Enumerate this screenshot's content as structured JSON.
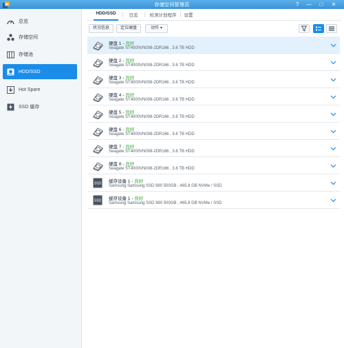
{
  "window": {
    "title": "存储空间管理员",
    "help": "?",
    "minimize": "—",
    "maximize": "□",
    "close": "✕"
  },
  "sidebar": {
    "items": [
      {
        "label": "总览",
        "icon": "gauge-icon"
      },
      {
        "label": "存储空间",
        "icon": "storage-space-icon"
      },
      {
        "label": "存储池",
        "icon": "storage-pool-icon"
      },
      {
        "label": "HDD/SSD",
        "icon": "hdd-icon"
      },
      {
        "label": "Hot Spare",
        "icon": "hot-spare-icon"
      },
      {
        "label": "SSD 缓存",
        "icon": "ssd-cache-icon"
      }
    ]
  },
  "tabs": [
    "HDD/SSD",
    "日志",
    "检测计划程序",
    "设置"
  ],
  "toolbar": {
    "health_info": "状况信息",
    "locate_drive": "定位硬盘",
    "action": "动作 ▾"
  },
  "drives": [
    {
      "name": "硬盘 1",
      "status": "良好",
      "model": "Seagate ST4000VN008-2DR166",
      "capacity": "3.6 TB HDD",
      "type": "hdd"
    },
    {
      "name": "硬盘 2",
      "status": "良好",
      "model": "Seagate ST4000VN008-2DR166",
      "capacity": "3.6 TB HDD",
      "type": "hdd"
    },
    {
      "name": "硬盘 3",
      "status": "良好",
      "model": "Seagate ST4000VN008-2DR166",
      "capacity": "3.6 TB HDD",
      "type": "hdd"
    },
    {
      "name": "硬盘 4",
      "status": "良好",
      "model": "Seagate ST4000VN008-2DR166",
      "capacity": "3.6 TB HDD",
      "type": "hdd"
    },
    {
      "name": "硬盘 5",
      "status": "良好",
      "model": "Seagate ST4000VN008-2DR166",
      "capacity": "3.6 TB HDD",
      "type": "hdd"
    },
    {
      "name": "硬盘 6",
      "status": "良好",
      "model": "Seagate ST4000VN008-2DR166",
      "capacity": "3.6 TB HDD",
      "type": "hdd"
    },
    {
      "name": "硬盘 7",
      "status": "良好",
      "model": "Seagate ST4000VN008-2DR166",
      "capacity": "3.6 TB HDD",
      "type": "hdd"
    },
    {
      "name": "硬盘 8",
      "status": "良好",
      "model": "Seagate ST4000VN008-2DR166",
      "capacity": "3.6 TB HDD",
      "type": "hdd"
    },
    {
      "name": "缓存设备 1",
      "status": "良好",
      "model": "Samsung Samsung SSD 980 500GB",
      "capacity": "465.8 GB NVMe / SSD",
      "type": "ssd"
    },
    {
      "name": "缓存设备 1",
      "status": "良好",
      "model": "Samsung Samsung SSD 980 500GB",
      "capacity": "465.8 GB NVMe / SSD",
      "type": "ssd"
    }
  ],
  "ssd_badge": "SSD",
  "colors": {
    "accent": "#1b8ce8",
    "good": "#3cab3c",
    "selected_row": "#e3f1fc"
  }
}
